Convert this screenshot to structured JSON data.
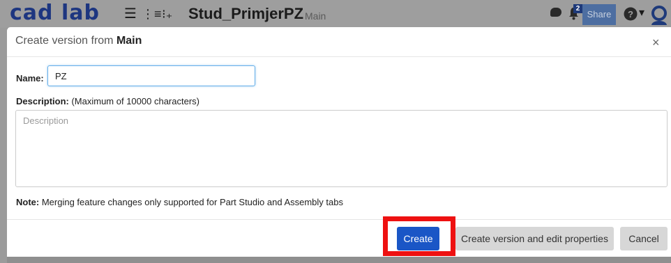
{
  "app": {
    "logo": "cad lab",
    "doc_title": "Stud_PrimjerPZ",
    "branch": "Main",
    "notification_count": "2",
    "share_label": "Share",
    "icons": [
      "hamburger-icon",
      "feature-list-icon",
      "insert-icon",
      "chat-icon",
      "bell-icon",
      "help-icon",
      "user-icon"
    ]
  },
  "dialog": {
    "title_prefix": "Create version from",
    "title_branch": "Main",
    "close": "×",
    "name_label": "Name:",
    "name_value": "PZ",
    "description_label": "Description:",
    "description_hint": "(Maximum of 10000 characters)",
    "description_placeholder": "Description",
    "note_label": "Note:",
    "note_text": "Merging feature changes only supported for Part Studio and Assembly tabs",
    "buttons": {
      "create": "Create",
      "create_edit": "Create version and edit properties",
      "cancel": "Cancel"
    }
  },
  "colors": {
    "primary": "#1a56c6",
    "highlight": "#ee1111",
    "logo": "#1d3680"
  }
}
